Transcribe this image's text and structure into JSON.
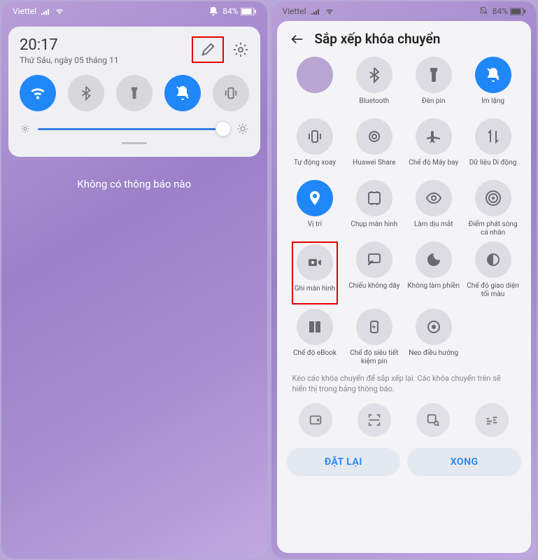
{
  "status": {
    "carrier": "Viettel",
    "battery_text": "84%"
  },
  "left": {
    "time": "20:17",
    "date": "Thứ Sáu, ngày 05 tháng 11",
    "no_notifications": "Không có thông báo nào"
  },
  "right": {
    "title": "Sắp xếp khóa chuyển",
    "tiles": [
      {
        "label": "",
        "icon": "placeholder",
        "on": false
      },
      {
        "label": "Bluetooth",
        "icon": "bluetooth",
        "on": false
      },
      {
        "label": "Đèn pin",
        "icon": "flashlight",
        "on": false
      },
      {
        "label": "Im lặng",
        "icon": "mute",
        "on": true
      },
      {
        "label": "Tự động xoay",
        "icon": "rotate",
        "on": false
      },
      {
        "label": "Huawei Share",
        "icon": "hshare",
        "on": false
      },
      {
        "label": "Chế độ Máy bay",
        "icon": "airplane",
        "on": false
      },
      {
        "label": "Dữ liệu Di động",
        "icon": "mobiledata",
        "on": false
      },
      {
        "label": "Vị trí",
        "icon": "location",
        "on": true
      },
      {
        "label": "Chụp màn hình",
        "icon": "screenshot",
        "on": false
      },
      {
        "label": "Làm dịu mắt",
        "icon": "eye",
        "on": false
      },
      {
        "label": "Điểm phát sóng cá nhân",
        "icon": "hotspot",
        "on": false
      },
      {
        "label": "Ghi màn hình",
        "icon": "record",
        "on": false,
        "highlight": true
      },
      {
        "label": "Chiếu không dây",
        "icon": "cast",
        "on": false
      },
      {
        "label": "Không làm phiền",
        "icon": "dnd",
        "on": false
      },
      {
        "label": "Chế độ giao diện tối màu",
        "icon": "dark",
        "on": false
      },
      {
        "label": "Chế độ eBook",
        "icon": "ebook",
        "on": false
      },
      {
        "label": "Chế độ siêu tiết kiệm pin",
        "icon": "battery",
        "on": false
      },
      {
        "label": "Neo điều hướng",
        "icon": "navdock",
        "on": false
      }
    ],
    "hint": "Kéo các khóa chuyển để sắp xếp lại. Các khóa chuyển trên sẽ hiển thị trong bảng thông báo.",
    "bottom_icons": [
      "nfc",
      "scan",
      "search-img",
      "sound"
    ],
    "reset_label": "ĐẶT LẠI",
    "done_label": "XONG"
  }
}
